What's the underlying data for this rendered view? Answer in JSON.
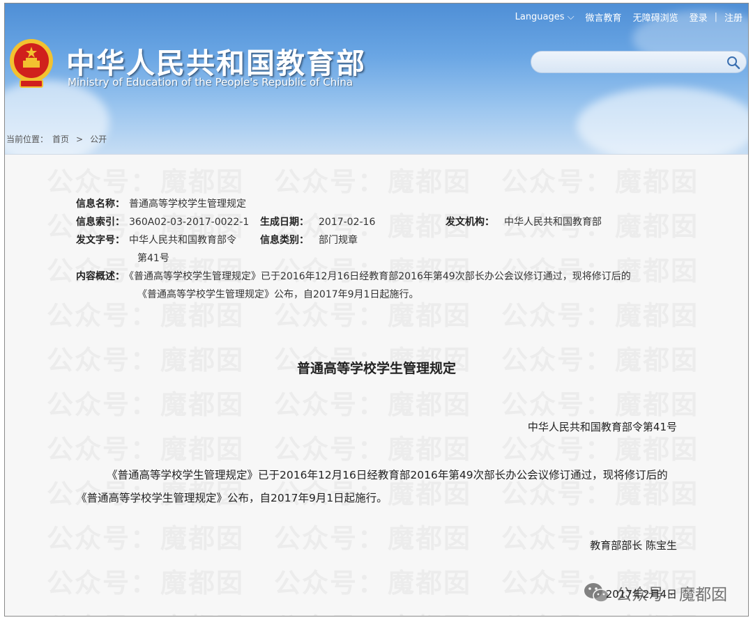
{
  "topnav": {
    "languages": "Languages",
    "weiyan": "微言教育",
    "accessible": "无障碍浏览",
    "login": "登录",
    "separator": "|",
    "register": "注册"
  },
  "site": {
    "title_cn": "中华人民共和国教育部",
    "title_en": "Ministry of Education of the People's Republic of China"
  },
  "search": {
    "value": "",
    "placeholder": ""
  },
  "breadcrumb": {
    "prefix": "当前位置：",
    "home": "首页",
    "sep": ">",
    "current": "公开"
  },
  "meta": {
    "name_label": "信息名称：",
    "name_value": "普通高等学校学生管理规定",
    "index_label": "信息索引：",
    "index_value": "360A02-03-2017-0022-1",
    "date_label": "生成日期：",
    "date_value": "2017-02-16",
    "org_label": "发文机构：",
    "org_value": "中华人民共和国教育部",
    "docno_label": "发文字号：",
    "docno_value_1": "中华人民共和国教育部令",
    "docno_value_2": "第41号",
    "type_label": "信息类别：",
    "type_value": "部门规章",
    "summary_label": "内容概述：",
    "summary_line1": "《普通高等学校学生管理规定》已于2016年12月16日经教育部2016年第49次部长办公会议修订通过，现将修订后的",
    "summary_line2": "《普通高等学校学生管理规定》公布，自2017年9月1日起施行。"
  },
  "document": {
    "title": "普通高等学校学生管理规定",
    "decree": "中华人民共和国教育部令第41号",
    "paragraph": "《普通高等学校学生管理规定》已于2016年12月16日经教育部2016年第49次部长办公会议修订通过，现将修订后的《普通高等学校学生管理规定》公布，自2017年9月1日起施行。",
    "signature": "教育部部长 陈宝生",
    "date": "2017年2月4日"
  },
  "watermark": {
    "text_a": "公众号：",
    "text_b": "魔都囡",
    "wechat_label": "公众号 · 魔都囡"
  },
  "colors": {
    "header_top": "#4f8fd6",
    "header_bottom": "#c6ddf4",
    "content_bg": "#f7f7f7",
    "emblem_red": "#d0201c",
    "emblem_gold": "#f2c230"
  }
}
